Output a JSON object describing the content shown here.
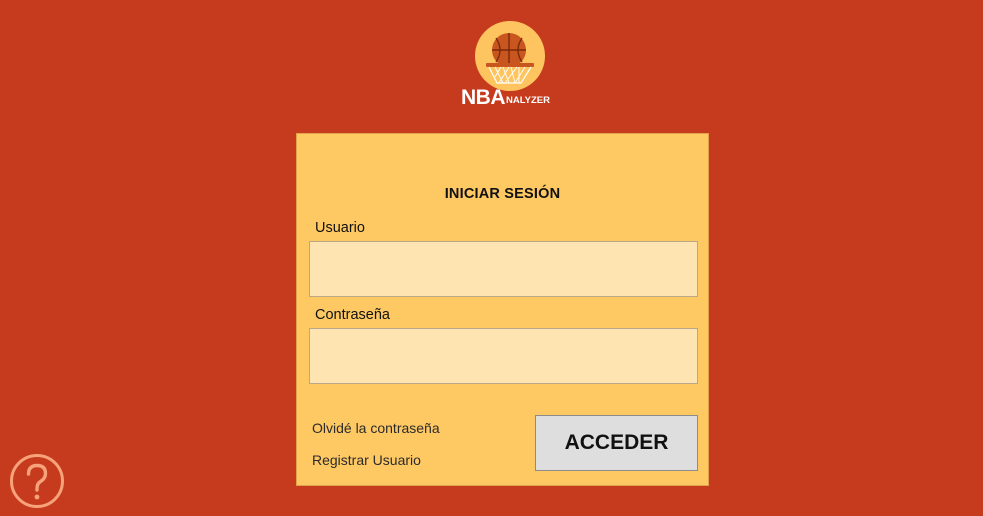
{
  "logo": {
    "title_big": "NBA",
    "title_small": "NALYZER"
  },
  "login": {
    "title": "INICIAR SESIÓN",
    "username_label": "Usuario",
    "username_value": "",
    "password_label": "Contraseña",
    "password_value": "",
    "forgot_link": "Olvidé la contraseña",
    "register_link": "Registrar Usuario",
    "submit_label": "ACCEDER"
  },
  "help": {
    "icon": "question-circle-icon"
  },
  "colors": {
    "background": "#c63b1e",
    "panel": "#fec863",
    "input": "#fde4b1",
    "button": "#dedede",
    "logo_circle": "#fdc45f",
    "help_icon": "#f6a27a"
  }
}
